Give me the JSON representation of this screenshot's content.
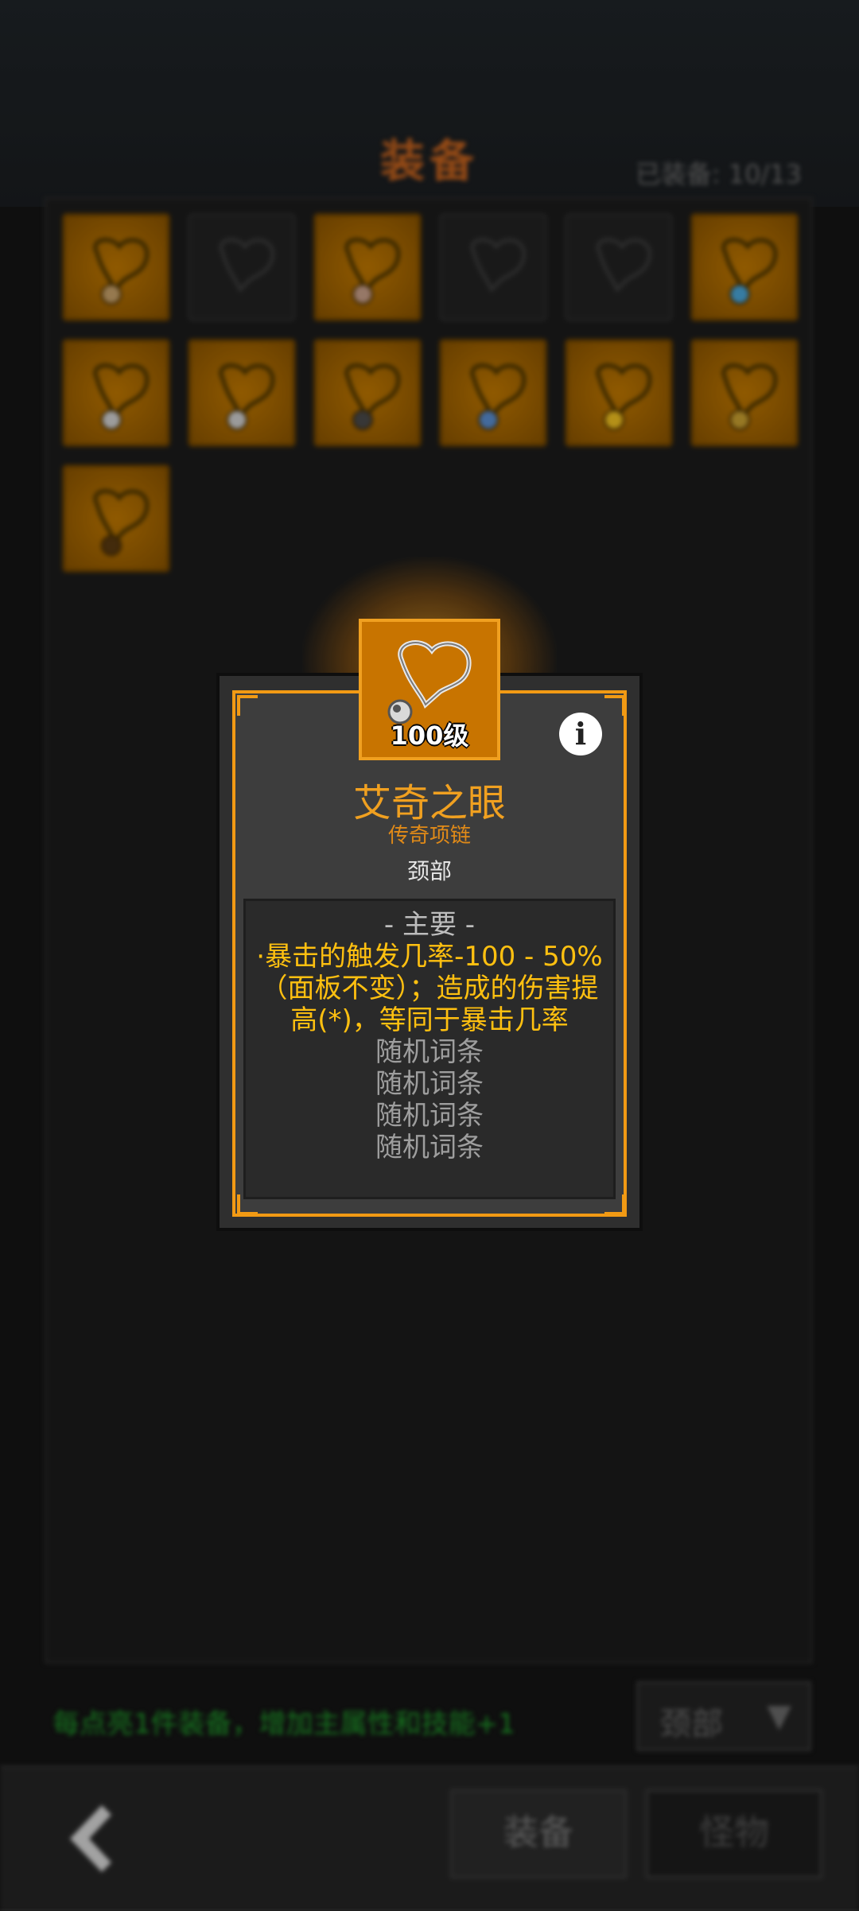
{
  "header": {
    "title": "装备",
    "equipped_count": "已装备: 10/13"
  },
  "inventory": {
    "slots": [
      {
        "state": "filled",
        "icon": "necklace-icon",
        "gem": "#c8a26a"
      },
      {
        "state": "empty",
        "icon": "necklace-icon"
      },
      {
        "state": "filled",
        "icon": "necklace-icon",
        "gem": "#c9a08a"
      },
      {
        "state": "empty",
        "icon": "necklace-icon"
      },
      {
        "state": "empty",
        "icon": "necklace-icon"
      },
      {
        "state": "filled",
        "icon": "necklace-icon",
        "gem": "#4aa6d8"
      },
      {
        "state": "filled",
        "icon": "necklace-icon",
        "gem": "#d0d0d0"
      },
      {
        "state": "filled",
        "icon": "necklace-icon",
        "gem": "#cfcfcf"
      },
      {
        "state": "filled",
        "icon": "necklace-icon",
        "gem": "#4a4a4a"
      },
      {
        "state": "filled",
        "icon": "necklace-icon",
        "gem": "#5a8ed0"
      },
      {
        "state": "filled",
        "icon": "necklace-icon",
        "gem": "#f0c020"
      },
      {
        "state": "filled",
        "icon": "necklace-icon",
        "gem": "#c9a030"
      },
      {
        "state": "filled",
        "icon": "necklace-icon",
        "gem": "#5a3a10"
      }
    ]
  },
  "footer": {
    "hint": "每点亮1件装备，增加主属性和技能+1",
    "slot_filter": "颈部",
    "filter_arrow": "▼",
    "back_icon": "chevron-left-icon",
    "tab_equip": "装备",
    "tab_monster": "怪物"
  },
  "tooltip": {
    "level": "100级",
    "info_icon": "i",
    "name": "艾奇之眼",
    "rarity": "传奇项链",
    "slot": "颈部",
    "section_header": "- 主要 -",
    "main_effect": "·暴击的触发几率-100 - 50%（面板不变）；造成的伤害提高(*)，等同于暴击几率",
    "random_affixes": [
      "随机词条",
      "随机词条",
      "随机词条",
      "随机词条"
    ],
    "accent_color": "#f29a14"
  }
}
